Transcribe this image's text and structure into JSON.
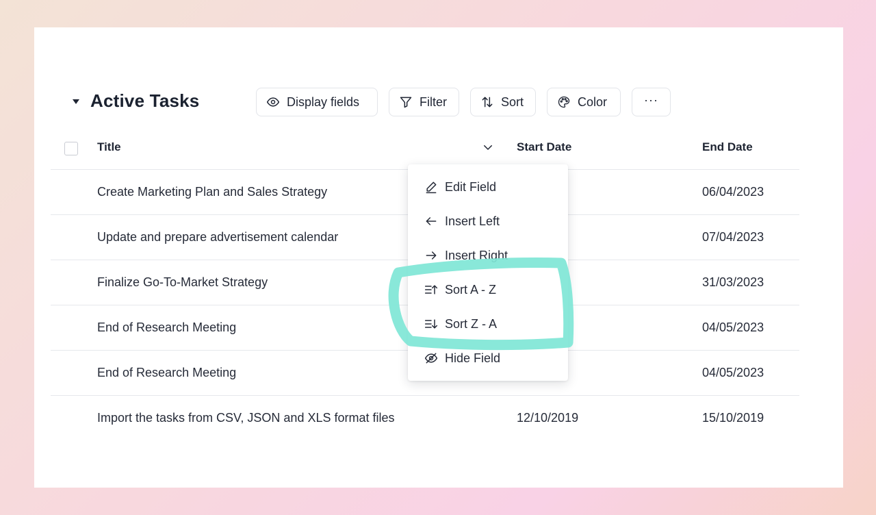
{
  "group": {
    "title": "Active Tasks"
  },
  "toolbar": {
    "display_fields": "Display fields",
    "filter": "Filter",
    "sort": "Sort",
    "color": "Color",
    "more": "···"
  },
  "table": {
    "columns": [
      "Title",
      "Start Date",
      "End Date"
    ],
    "rows": [
      {
        "title": "Create Marketing Plan and Sales Strategy",
        "start": "023",
        "end": "06/04/2023"
      },
      {
        "title": "Update and prepare advertisement calendar",
        "start": "023",
        "end": "07/04/2023"
      },
      {
        "title": "Finalize Go-To-Market Strategy",
        "start": "023",
        "end": "31/03/2023"
      },
      {
        "title": "End of Research Meeting",
        "start": "23",
        "end": "04/05/2023"
      },
      {
        "title": "End of Research Meeting",
        "start": "23",
        "end": "04/05/2023"
      },
      {
        "title": "Import the tasks from CSV, JSON and XLS format files",
        "start": "12/10/2019",
        "end": "15/10/2019"
      }
    ]
  },
  "column_menu": {
    "items": [
      "Edit Field",
      "Insert Left",
      "Insert Right",
      "Sort A - Z",
      "Sort Z - A",
      "Hide Field"
    ]
  },
  "colors": {
    "highlight": "#7fe6d6",
    "text": "#1f2533",
    "border": "#e2e4e9"
  }
}
